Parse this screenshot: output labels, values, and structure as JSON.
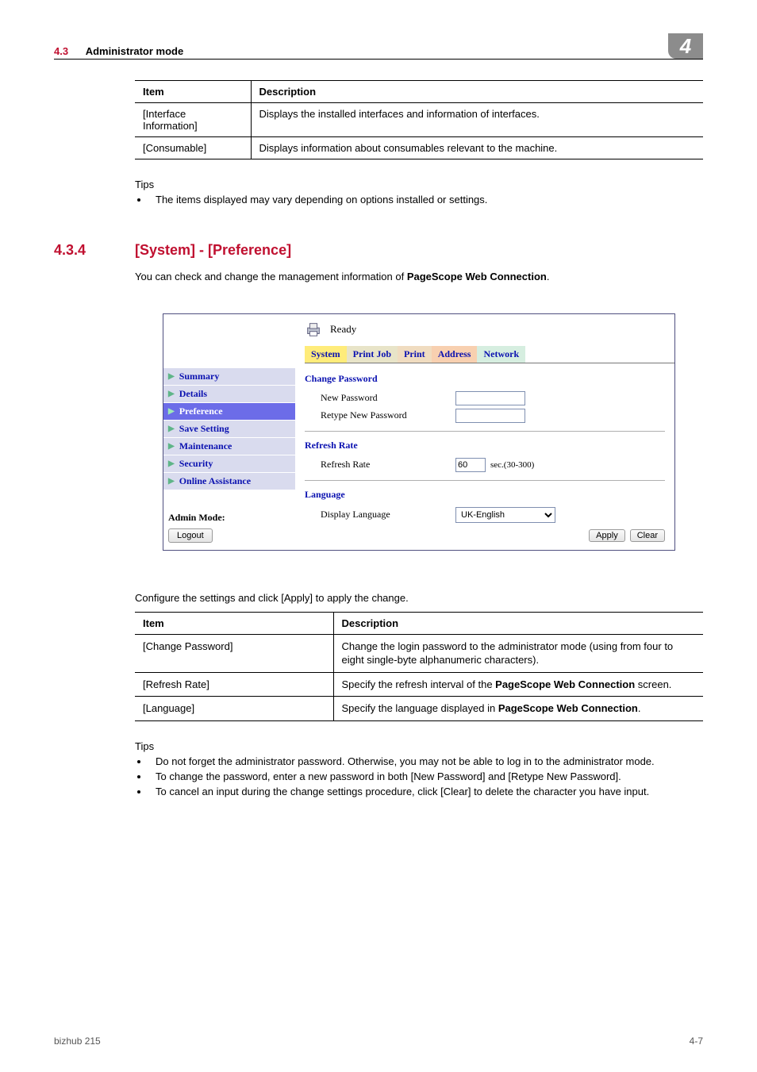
{
  "header": {
    "section_num": "4.3",
    "section_title": "Administrator mode",
    "chapter_badge": "4"
  },
  "table1": {
    "headers": [
      "Item",
      "Description"
    ],
    "rows": [
      [
        "[Interface Information]",
        "Displays the installed interfaces and information of interfaces."
      ],
      [
        "[Consumable]",
        "Displays information about consumables relevant to the machine."
      ]
    ]
  },
  "tips1": {
    "label": "Tips",
    "items": [
      "The items displayed may vary depending on options installed or settings."
    ]
  },
  "section2": {
    "num": "4.3.4",
    "title": "[System] - [Preference]",
    "intro_pre": "You can check and change the management information of ",
    "intro_bold": "PageScope Web Connection",
    "intro_post": "."
  },
  "screenshot": {
    "status": "Ready",
    "tabs": [
      "System",
      "Print Job",
      "Print",
      "Address",
      "Network"
    ],
    "sidebar": {
      "items": [
        "Summary",
        "Details",
        "Preference",
        "Save Setting",
        "Maintenance",
        "Security",
        "Online Assistance"
      ],
      "active_index": 2
    },
    "admin_mode_label": "Admin Mode:",
    "logout_label": "Logout",
    "groups": {
      "change_password": {
        "title": "Change Password",
        "new_password_label": "New Password",
        "retype_label": "Retype New Password"
      },
      "refresh_rate": {
        "title": "Refresh Rate",
        "label": "Refresh Rate",
        "value": "60",
        "unit": "sec.(30-300)"
      },
      "language": {
        "title": "Language",
        "label": "Display Language",
        "value": "UK-English"
      }
    },
    "apply_label": "Apply",
    "clear_label": "Clear"
  },
  "config_text": "Configure the settings and click [Apply] to apply the change.",
  "table2": {
    "headers": [
      "Item",
      "Description"
    ],
    "rows": [
      {
        "item": "[Change Password]",
        "desc": "Change the login password to the administrator mode (using from four to eight single-byte alphanumeric characters)."
      },
      {
        "item": "[Refresh Rate]",
        "desc_pre": "Specify the refresh interval of the ",
        "desc_bold": "PageScope Web Connection",
        "desc_post": " screen."
      },
      {
        "item": "[Language]",
        "desc_pre": "Specify the language displayed in ",
        "desc_bold": "PageScope Web Connection",
        "desc_post": "."
      }
    ]
  },
  "tips2": {
    "label": "Tips",
    "items": [
      "Do not forget the administrator password. Otherwise, you may not be able to log in to the administrator mode.",
      "To change the password, enter a new password in both [New Password] and [Retype New Password].",
      "To cancel an input during the change settings procedure, click [Clear] to delete the character you have input."
    ]
  },
  "footer": {
    "left": "bizhub 215",
    "right": "4-7"
  }
}
